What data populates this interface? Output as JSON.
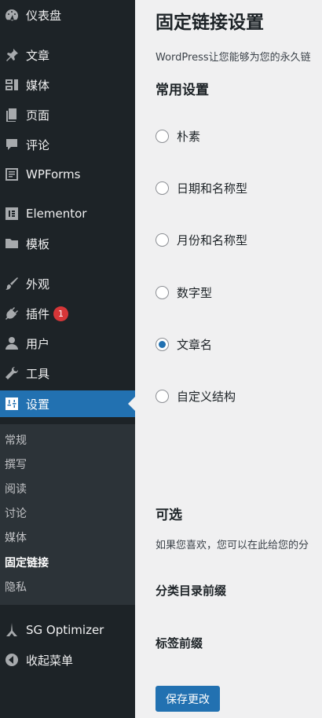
{
  "sidebar": {
    "items": [
      {
        "label": "仪表盘",
        "icon": "dashboard-icon"
      },
      {
        "label": "文章",
        "icon": "pin-icon"
      },
      {
        "label": "媒体",
        "icon": "media-icon"
      },
      {
        "label": "页面",
        "icon": "page-icon"
      },
      {
        "label": "评论",
        "icon": "comment-icon"
      },
      {
        "label": "WPForms",
        "icon": "wpforms-icon"
      },
      {
        "label": "Elementor",
        "icon": "elementor-icon"
      },
      {
        "label": "模板",
        "icon": "folder-icon"
      },
      {
        "label": "外观",
        "icon": "brush-icon"
      },
      {
        "label": "插件",
        "icon": "plugin-icon",
        "badge": "1"
      },
      {
        "label": "用户",
        "icon": "user-icon"
      },
      {
        "label": "工具",
        "icon": "wrench-icon"
      },
      {
        "label": "设置",
        "icon": "settings-icon",
        "active": true
      },
      {
        "label": "SG Optimizer",
        "icon": "sg-optimizer-icon"
      },
      {
        "label": "收起菜单",
        "icon": "collapse-icon"
      }
    ],
    "submenu": [
      {
        "label": "常规"
      },
      {
        "label": "撰写"
      },
      {
        "label": "阅读"
      },
      {
        "label": "讨论"
      },
      {
        "label": "媒体"
      },
      {
        "label": "固定链接",
        "current": true
      },
      {
        "label": "隐私"
      }
    ]
  },
  "main": {
    "title": "固定链接设置",
    "intro": "WordPress让您能够为您的永久链",
    "common_settings": {
      "title": "常用设置",
      "options": [
        {
          "label": "朴素",
          "checked": false
        },
        {
          "label": "日期和名称型",
          "checked": false
        },
        {
          "label": "月份和名称型",
          "checked": false
        },
        {
          "label": "数字型",
          "checked": false
        },
        {
          "label": "文章名",
          "checked": true
        },
        {
          "label": "自定义结构",
          "checked": false
        }
      ]
    },
    "optional": {
      "title": "可选",
      "description": "如果您喜欢，您可以在此给您的分",
      "category_base_label": "分类目录前缀",
      "tag_base_label": "标签前缀"
    },
    "save_button": "保存更改"
  },
  "colors": {
    "sidebar_bg": "#1d2327",
    "submenu_bg": "#2c3338",
    "accent": "#2271b1",
    "badge": "#d63638",
    "content_bg": "#f0f0f1"
  }
}
